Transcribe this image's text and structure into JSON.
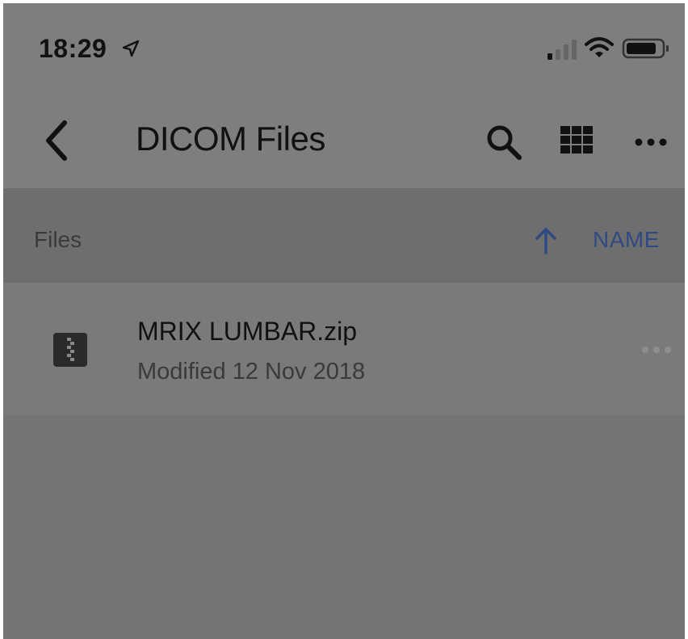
{
  "status_bar": {
    "time": "18:29",
    "icons": [
      "location-arrow-icon",
      "signal-icon",
      "wifi-icon",
      "battery-icon"
    ]
  },
  "nav": {
    "title": "DICOM Files",
    "icons": [
      "back-icon",
      "search-icon",
      "grid-view-icon",
      "more-icon"
    ]
  },
  "section": {
    "label": "Files",
    "sort_label": "NAME",
    "sort_icon": "arrow-up-icon"
  },
  "files": [
    {
      "name": "MRIX LUMBAR.zip",
      "meta": "Modified 12 Nov 2018",
      "icon": "zip-file-icon"
    }
  ],
  "colors": {
    "sort_accent": "#2f4a82",
    "overlay_gray": "#787878"
  }
}
